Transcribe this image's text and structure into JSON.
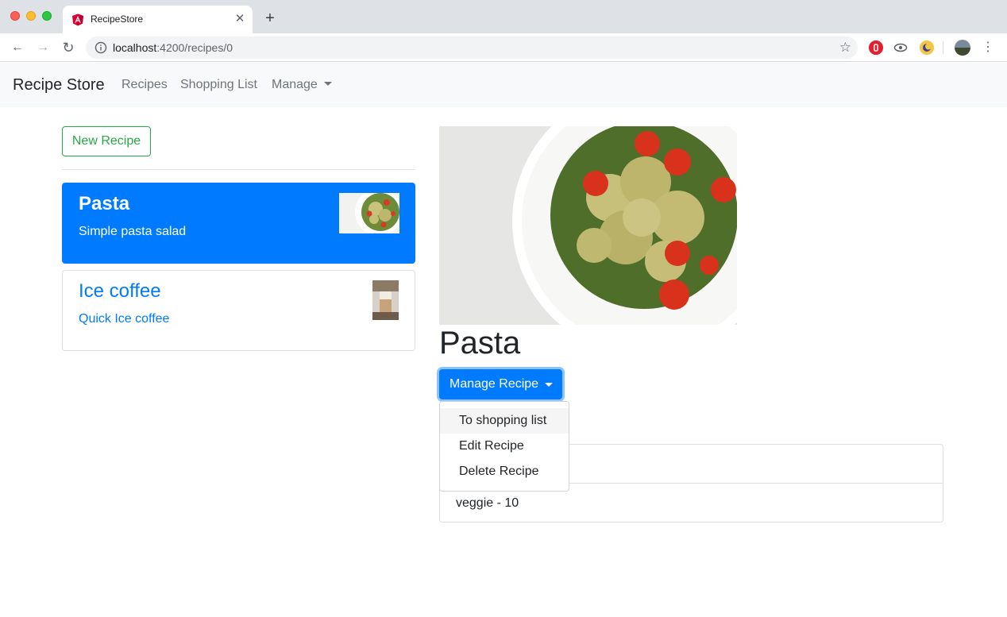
{
  "browser": {
    "tab_title": "RecipeStore",
    "tab_close": "✕",
    "new_tab": "+",
    "url_host": "localhost",
    "url_path": ":4200/recipes/0",
    "back": "←",
    "forward": "→",
    "reload": "↻",
    "star": "☆",
    "menu": "⋮",
    "icons": [
      "angular-favicon",
      "info-icon",
      "star-icon",
      "ublock-icon",
      "eye-icon",
      "moon-icon",
      "profile-avatar",
      "menu-dots-icon"
    ]
  },
  "navbar": {
    "brand": "Recipe Store",
    "links": [
      {
        "label": "Recipes"
      },
      {
        "label": "Shopping List"
      },
      {
        "label": "Manage"
      }
    ]
  },
  "sidebar": {
    "new_recipe_label": "New Recipe",
    "recipes": [
      {
        "name": "Pasta",
        "description": "Simple pasta salad",
        "active": true
      },
      {
        "name": "Ice coffee",
        "description": "Quick Ice coffee",
        "active": false
      }
    ]
  },
  "detail": {
    "title": "Pasta",
    "manage_label": "Manage Recipe",
    "dropdown": [
      "To shopping list",
      "Edit Recipe",
      "Delete Recipe"
    ],
    "ingredients": [
      "",
      "veggie - 10"
    ]
  },
  "colors": {
    "primary": "#007bff",
    "success": "#28a745",
    "navbar_bg": "#f8f9fa"
  }
}
